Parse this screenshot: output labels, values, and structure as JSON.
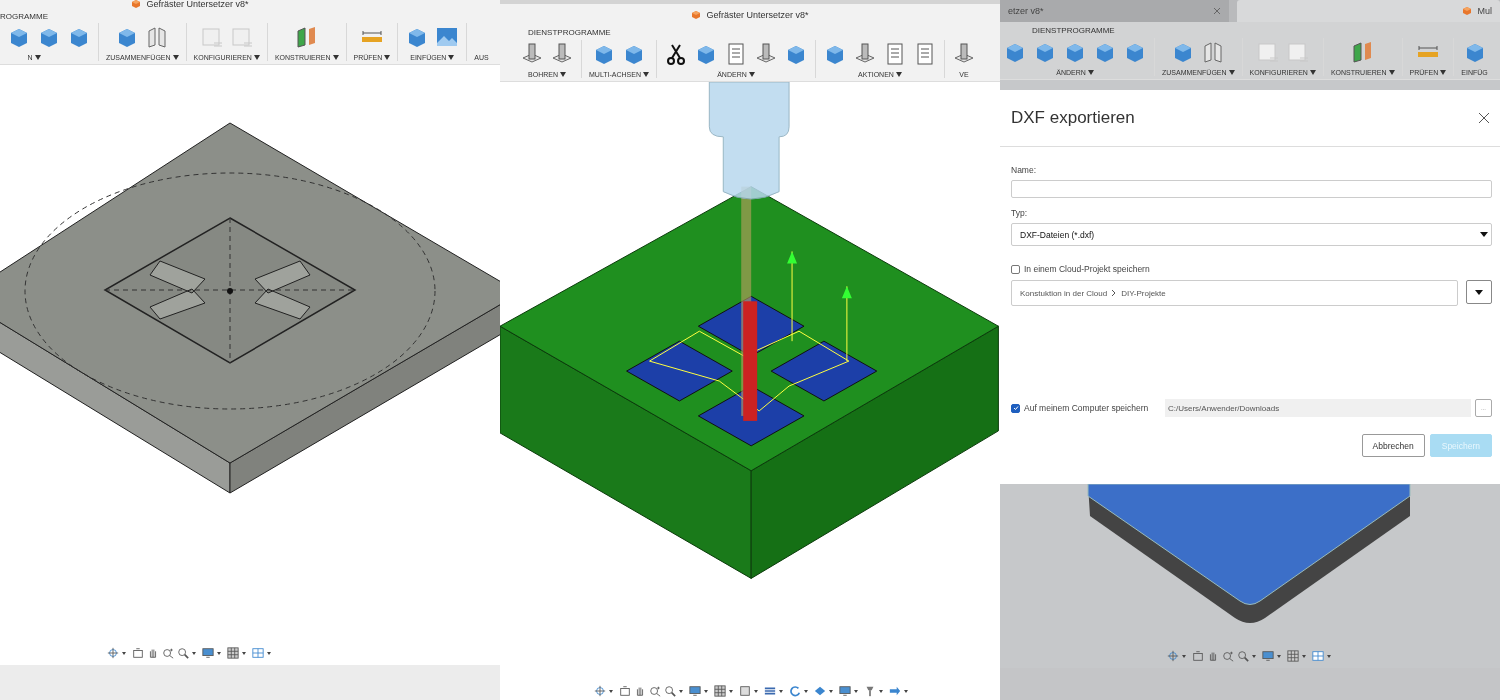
{
  "panels": [
    {
      "kind": "design",
      "title": "Gefräster Untersetzer v8*",
      "section_label": "ROGRAMME",
      "groups": [
        {
          "label": "N",
          "menu": true
        },
        {
          "label": "ZUSAMMENFÜGEN",
          "menu": true
        },
        {
          "label": "KONFIGURIEREN",
          "menu": true
        },
        {
          "label": "KONSTRUIEREN",
          "menu": true
        },
        {
          "label": "PRÜFEN",
          "menu": true
        },
        {
          "label": "EINFÜGEN",
          "menu": true
        },
        {
          "label": "AUS",
          "menu": false
        }
      ]
    },
    {
      "kind": "manufacture",
      "title": "Gefräster Untersetzer v8*",
      "section_label": "DIENSTPROGRAMME",
      "groups": [
        {
          "label": "BOHREN",
          "menu": true
        },
        {
          "label": "MULTI-ACHSEN",
          "menu": true
        },
        {
          "label": "ÄNDERN",
          "menu": true
        },
        {
          "label": "AKTIONEN",
          "menu": true
        },
        {
          "label": "VE",
          "menu": false
        }
      ]
    },
    {
      "kind": "export",
      "tabs": [
        {
          "label": "etzer v8*",
          "selected": false
        },
        {
          "label": "Mul",
          "selected": true
        }
      ],
      "section_label": "DIENSTPROGRAMME",
      "groups": [
        {
          "label": "ÄNDERN",
          "menu": true
        },
        {
          "label": "ZUSAMMENFÜGEN",
          "menu": true
        },
        {
          "label": "KONFIGURIEREN",
          "menu": true
        },
        {
          "label": "KONSTRUIEREN",
          "menu": true
        },
        {
          "label": "PRÜFEN",
          "menu": true
        },
        {
          "label": "EINFÜG",
          "menu": false
        }
      ],
      "dialog": {
        "title": "DXF exportieren",
        "name_label": "Name:",
        "type_label": "Typ:",
        "type_value": "DXF-Dateien (*.dxf)",
        "cloud": {
          "label": "In einem Cloud-Projekt speichern",
          "checked": false
        },
        "cloud_path": [
          "Konstuktion in der Cloud",
          "DIY-Projekte"
        ],
        "computer": {
          "label": "Auf meinem Computer speichern",
          "checked": true
        },
        "computer_path": "C:/Users/Anwender/Downloads",
        "browse": "...",
        "buttons": [
          {
            "label": "Abbrechen",
            "disabled": false
          },
          {
            "label": "Speichern",
            "disabled": true
          }
        ]
      }
    }
  ]
}
